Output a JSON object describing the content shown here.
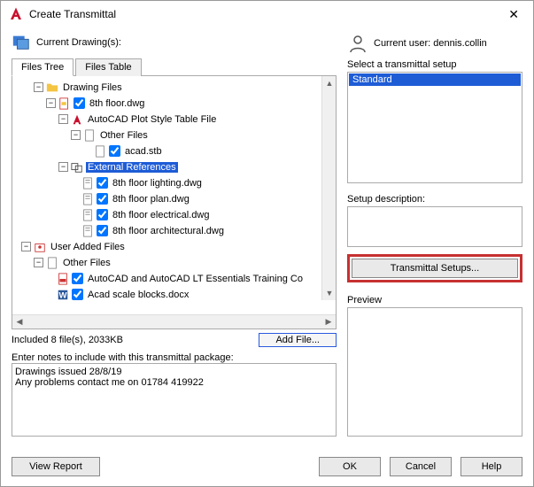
{
  "window": {
    "title": "Create Transmittal"
  },
  "left": {
    "current_drawings_label": "Current Drawing(s):",
    "tabs": {
      "tree": "Files Tree",
      "table": "Files Table"
    },
    "tree": {
      "drawing_files": "Drawing Files",
      "dwg_8th": "8th floor.dwg",
      "plot_style": "AutoCAD Plot Style Table File",
      "other_files": "Other Files",
      "acad_stb": "acad.stb",
      "ext_refs": "External References",
      "lighting": "8th floor lighting.dwg",
      "plan": "8th floor plan.dwg",
      "electrical": "8th floor electrical.dwg",
      "arch": "8th floor architectural.dwg",
      "user_added": "User Added Files",
      "other_files2": "Other Files",
      "essentials": "AutoCAD and AutoCAD LT Essentials Training Co",
      "scale_blocks": "Acad scale blocks.docx"
    },
    "status": "Included 8 file(s), 2033KB",
    "add_file": "Add File...",
    "notes_label": "Enter notes to include with this transmittal package:",
    "notes_value": "Drawings issued 28/8/19\nAny problems contact me on 01784 419922"
  },
  "right": {
    "current_user_label": "Current user: dennis.collin",
    "select_setup_label": "Select a transmittal setup",
    "setup_item": "Standard",
    "desc_label": "Setup description:",
    "setups_btn": "Transmittal Setups...",
    "preview_label": "Preview"
  },
  "buttons": {
    "view_report": "View Report",
    "ok": "OK",
    "cancel": "Cancel",
    "help": "Help"
  }
}
